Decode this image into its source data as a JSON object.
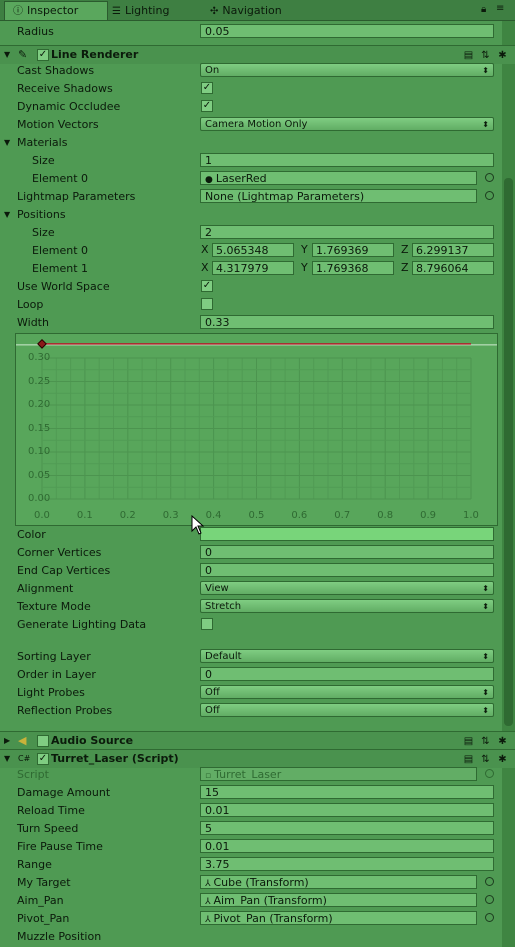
{
  "tabs": [
    {
      "label": "Inspector",
      "icon": "info-icon"
    },
    {
      "label": "Lighting",
      "icon": "lighting-icon"
    },
    {
      "label": "Navigation",
      "icon": "navigation-icon"
    }
  ],
  "top": {
    "radius_label": "Radius",
    "radius_value": "0.05"
  },
  "line_renderer": {
    "title": "Line Renderer",
    "cast_shadows": {
      "label": "Cast Shadows",
      "value": "On"
    },
    "receive_shadows": {
      "label": "Receive Shadows",
      "checked": true
    },
    "dynamic_occludee": {
      "label": "Dynamic Occludee",
      "checked": true
    },
    "motion_vectors": {
      "label": "Motion Vectors",
      "value": "Camera Motion Only"
    },
    "materials": {
      "label": "Materials",
      "size_label": "Size",
      "size": "1",
      "element_label": "Element 0",
      "element_value": "LaserRed"
    },
    "lightmap": {
      "label": "Lightmap Parameters",
      "value": "None (Lightmap Parameters)"
    },
    "positions": {
      "label": "Positions",
      "size_label": "Size",
      "size": "2",
      "elements": [
        {
          "label": "Element 0",
          "x": "5.065348",
          "y": "1.769369",
          "z": "6.299137"
        },
        {
          "label": "Element 1",
          "x": "4.317979",
          "y": "1.769368",
          "z": "8.796064"
        }
      ]
    },
    "use_world_space": {
      "label": "Use World Space",
      "checked": true
    },
    "loop": {
      "label": "Loop",
      "checked": false
    },
    "width": {
      "label": "Width",
      "value": "0.33"
    },
    "curve": {
      "y_ticks": [
        "0.30",
        "0.25",
        "0.20",
        "0.15",
        "0.10",
        "0.05",
        "0.00"
      ],
      "x_ticks": [
        "0.0",
        "0.1",
        "0.2",
        "0.3",
        "0.4",
        "0.5",
        "0.6",
        "0.7",
        "0.8",
        "0.9",
        "1.0"
      ],
      "value": 0.33,
      "line_color": "#b0202a"
    },
    "color": {
      "label": "Color",
      "value": "#78d57a"
    },
    "corner_vertices": {
      "label": "Corner Vertices",
      "value": "0"
    },
    "end_cap_vertices": {
      "label": "End Cap Vertices",
      "value": "0"
    },
    "alignment": {
      "label": "Alignment",
      "value": "View"
    },
    "texture_mode": {
      "label": "Texture Mode",
      "value": "Stretch"
    },
    "generate_lighting": {
      "label": "Generate Lighting Data",
      "checked": false
    },
    "sorting_layer": {
      "label": "Sorting Layer",
      "value": "Default"
    },
    "order_in_layer": {
      "label": "Order in Layer",
      "value": "0"
    },
    "light_probes": {
      "label": "Light Probes",
      "value": "Off"
    },
    "reflection_probes": {
      "label": "Reflection Probes",
      "value": "Off"
    }
  },
  "audio_source": {
    "title": "Audio Source"
  },
  "turret": {
    "title": "Turret_Laser (Script)",
    "script": {
      "label": "Script",
      "value": "Turret_Laser"
    },
    "damage": {
      "label": "Damage Amount",
      "value": "15"
    },
    "reload": {
      "label": "Reload Time",
      "value": "0.01"
    },
    "turn": {
      "label": "Turn Speed",
      "value": "5"
    },
    "fire_pause": {
      "label": "Fire Pause Time",
      "value": "0.01"
    },
    "range": {
      "label": "Range",
      "value": "3.75"
    },
    "my_target": {
      "label": "My Target",
      "value": "Cube (Transform)"
    },
    "aim_pan": {
      "label": "Aim_Pan",
      "value": "Aim_Pan (Transform)"
    },
    "pivot_pan": {
      "label": "Pivot_Pan",
      "value": "Pivot_Pan (Transform)"
    },
    "muzzle": {
      "label": "Muzzle Position"
    }
  }
}
